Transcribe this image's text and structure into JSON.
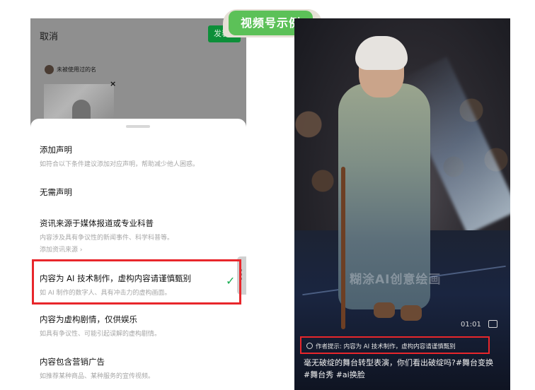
{
  "badge": {
    "label": "视频号示例"
  },
  "left_screen": {
    "cancel_label": "取消",
    "publish_label": "发表",
    "user_name": "未被使用过的名",
    "thumb_close": "×",
    "options": [
      {
        "title": "添加声明",
        "subtitle": "如符合以下条件建议添加对应声明，帮助减少他人困惑。"
      },
      {
        "title": "无需声明"
      },
      {
        "title": "资讯来源于媒体报道或专业科普",
        "subtitle": "内容涉及具有争议性的新闻事件、科学科普等。",
        "link": "添加资讯来源 ›"
      },
      {
        "title": "内容为 AI 技术制作，虚构内容请谨慎甄别",
        "subtitle": "如 AI 制作的数字人、具有冲击力的虚构画面。",
        "selected": true
      },
      {
        "title": "内容为虚构剧情，仅供娱乐",
        "subtitle": "如具有争议性、可能引起误解的虚构剧情。"
      },
      {
        "title": "内容包含营销广告",
        "subtitle": "如推荐某种商品、某种服务的宣传视频。"
      }
    ],
    "check_mark": "✓"
  },
  "right_screen": {
    "watermark": "糊涂AI创意绘画",
    "duration": "01:01",
    "notice": "作者提示: 内容为 AI 技术制作，虚构内容请谨慎甄别",
    "caption_line1": "毫无破绽的舞台转型表演，你们看出破绽吗?#舞台变换",
    "caption_line2": "#舞台秀 #ai换脸"
  },
  "colors": {
    "publish_green": "#0d8f39",
    "badge_green": "#5cc158",
    "highlight_red": "#e8262b",
    "check_green": "#1aad53"
  }
}
